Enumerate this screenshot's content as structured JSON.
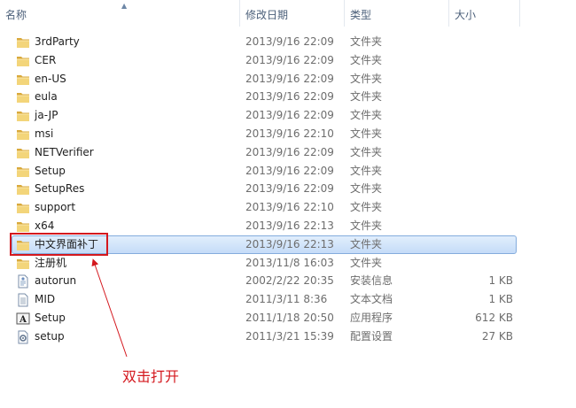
{
  "columns": {
    "name": "名称",
    "date": "修改日期",
    "type": "类型",
    "size": "大小"
  },
  "files": [
    {
      "name": "3rdParty",
      "date": "2013/9/16 22:09",
      "type": "文件夹",
      "size": "",
      "icon": "folder-icon"
    },
    {
      "name": "CER",
      "date": "2013/9/16 22:09",
      "type": "文件夹",
      "size": "",
      "icon": "folder-icon"
    },
    {
      "name": "en-US",
      "date": "2013/9/16 22:09",
      "type": "文件夹",
      "size": "",
      "icon": "folder-icon"
    },
    {
      "name": "eula",
      "date": "2013/9/16 22:09",
      "type": "文件夹",
      "size": "",
      "icon": "folder-icon"
    },
    {
      "name": "ja-JP",
      "date": "2013/9/16 22:09",
      "type": "文件夹",
      "size": "",
      "icon": "folder-icon"
    },
    {
      "name": "msi",
      "date": "2013/9/16 22:10",
      "type": "文件夹",
      "size": "",
      "icon": "folder-icon"
    },
    {
      "name": "NETVerifier",
      "date": "2013/9/16 22:09",
      "type": "文件夹",
      "size": "",
      "icon": "folder-icon"
    },
    {
      "name": "Setup",
      "date": "2013/9/16 22:09",
      "type": "文件夹",
      "size": "",
      "icon": "folder-icon"
    },
    {
      "name": "SetupRes",
      "date": "2013/9/16 22:09",
      "type": "文件夹",
      "size": "",
      "icon": "folder-icon"
    },
    {
      "name": "support",
      "date": "2013/9/16 22:10",
      "type": "文件夹",
      "size": "",
      "icon": "folder-icon"
    },
    {
      "name": "x64",
      "date": "2013/9/16 22:13",
      "type": "文件夹",
      "size": "",
      "icon": "folder-icon"
    },
    {
      "name": "中文界面补丁",
      "date": "2013/9/16 22:13",
      "type": "文件夹",
      "size": "",
      "icon": "folder-icon",
      "selected": true
    },
    {
      "name": "注册机",
      "date": "2013/11/8 16:03",
      "type": "文件夹",
      "size": "",
      "icon": "folder-icon"
    },
    {
      "name": "autorun",
      "date": "2002/2/22 20:35",
      "type": "安装信息",
      "size": "1 KB",
      "icon": "setup-info-icon"
    },
    {
      "name": "MID",
      "date": "2011/3/11 8:36",
      "type": "文本文档",
      "size": "1 KB",
      "icon": "text-document-icon"
    },
    {
      "name": "Setup",
      "date": "2011/1/18 20:50",
      "type": "应用程序",
      "size": "612 KB",
      "icon": "application-icon"
    },
    {
      "name": "setup",
      "date": "2011/3/21 15:39",
      "type": "配置设置",
      "size": "27 KB",
      "icon": "config-settings-icon"
    }
  ],
  "annotation": {
    "text": "双击打开"
  },
  "colors": {
    "highlight": "#d4181e",
    "selection": "#c5dcf8",
    "folder": "#e8c55b"
  }
}
